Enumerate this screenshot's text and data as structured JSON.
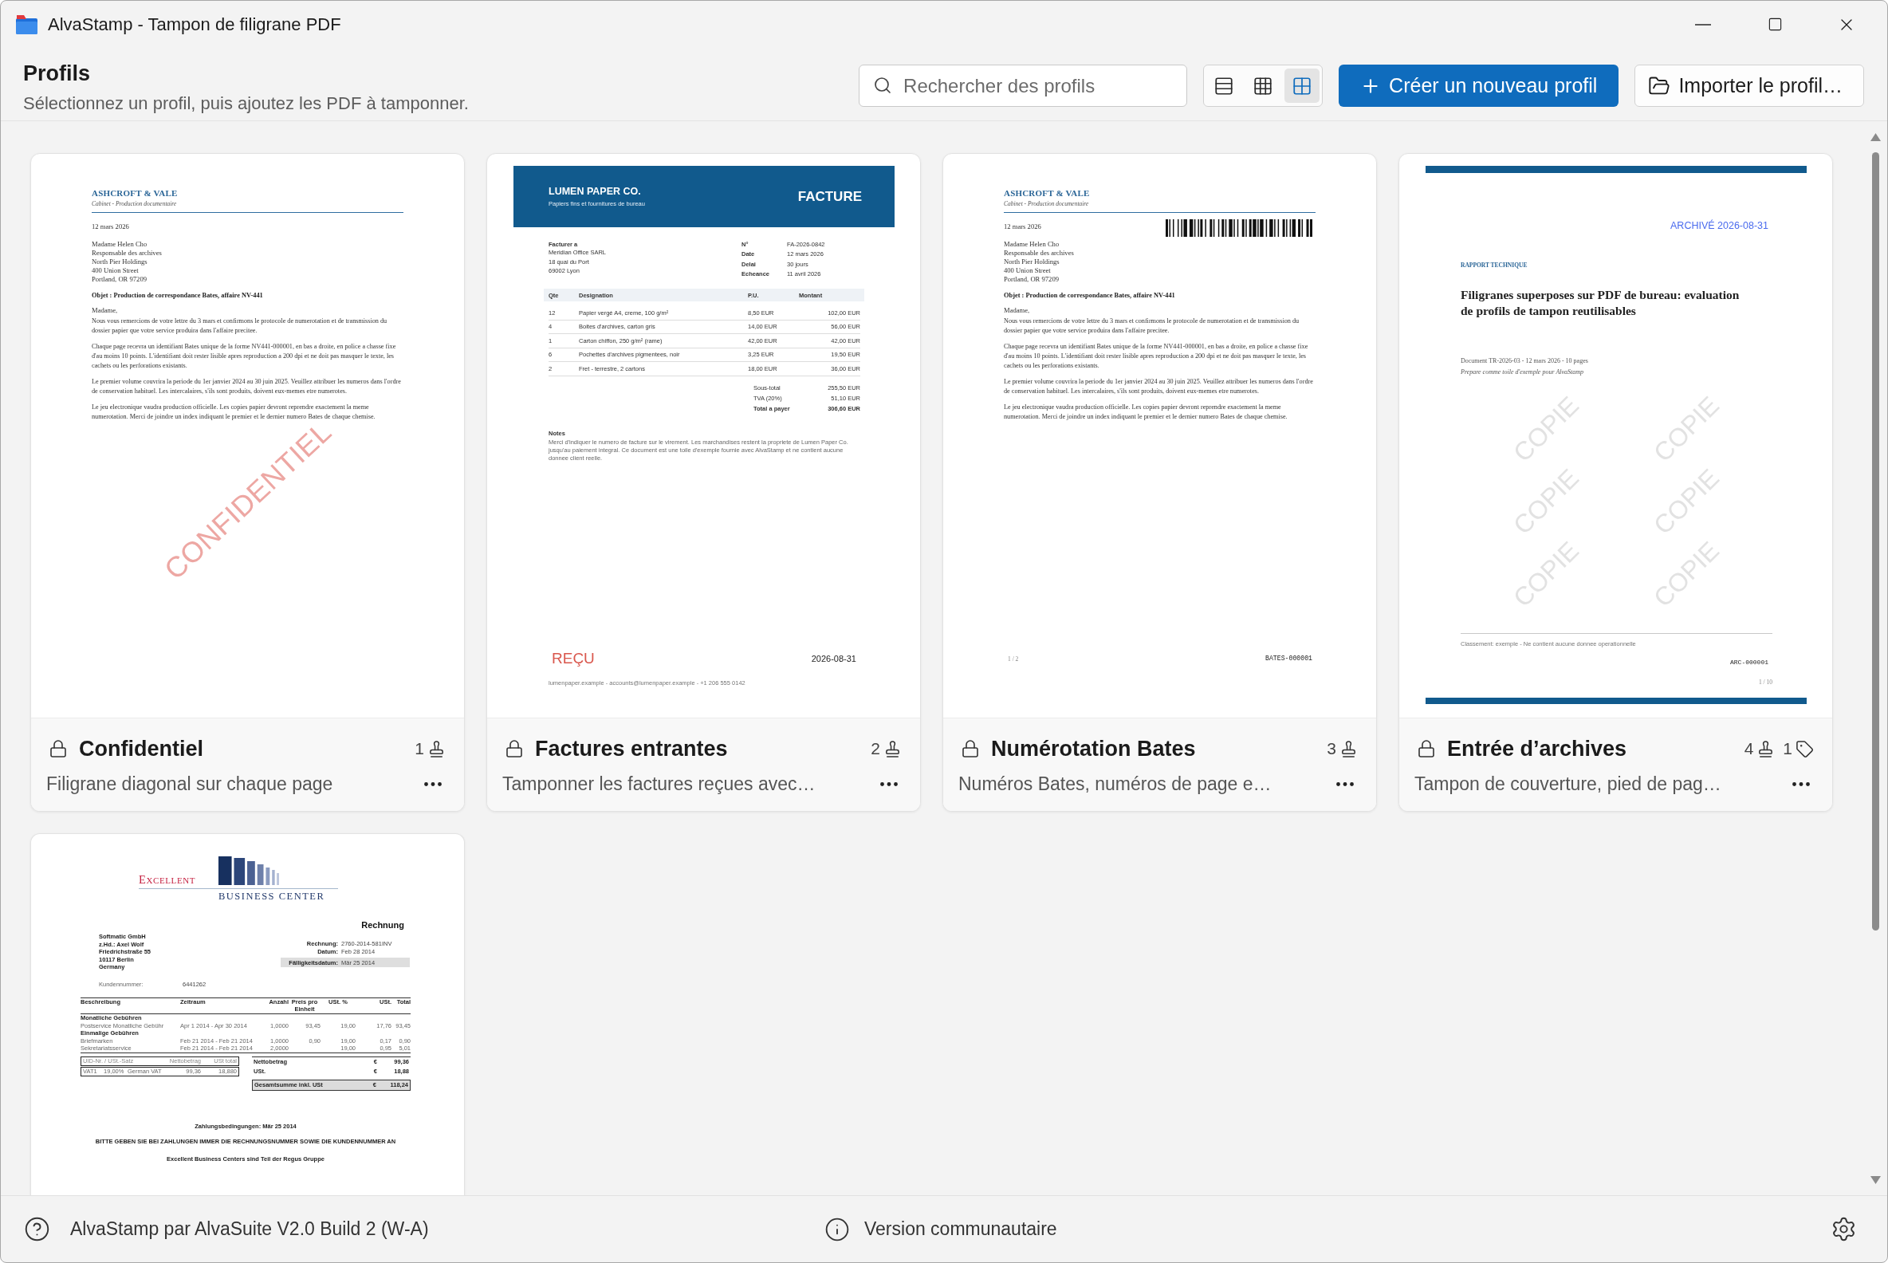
{
  "window": {
    "title": "AlvaStamp - Tampon de filigrane PDF"
  },
  "header": {
    "title": "Profils",
    "subtitle": "Sélectionnez un profil, puis ajoutez les PDF à tamponner.",
    "search": {
      "placeholder": "Rechercher des profils"
    },
    "view_modes": [
      {
        "kind": "list",
        "selected": false
      },
      {
        "kind": "grid",
        "selected": false
      },
      {
        "kind": "tiles",
        "selected": true
      }
    ],
    "create_button": "Créer un nouveau profil",
    "import_button": "Importer le profil…"
  },
  "profiles": [
    {
      "title": "Confidentiel",
      "description": "Filigrane diagonal sur chaque page",
      "locked": true,
      "stamp_count": "1",
      "preview": {
        "kind": "letter",
        "company": "ASHCROFT & VALE",
        "tagline": "Cabinet - Production documentaire",
        "date": "12 mars 2026",
        "address": [
          "Madame Helen Cho",
          "Responsable des archives",
          "North Pier Holdings",
          "400 Union Street",
          "Portland, OR 97209"
        ],
        "subject": "Objet : Production de correspondance Bates, affaire NV-441",
        "salutation": "Madame,",
        "paragraphs": [
          "Nous vous remercions de votre lettre du 3 mars et confirmons le protocole de numerotation et de transmission du dossier papier que votre service produira dans l'affaire precitee.",
          "Chaque page recevra un identifiant Bates unique de la forme NV441-000001, en bas a droite, en police a chasse fixe d'au moins 10 points. L'identifiant doit rester lisible apres reproduction a 200 dpi et ne doit pas masquer le texte, les cachets ou les perforations existants.",
          "Le premier volume couvrira la periode du 1er janvier 2024 au 30 juin 2025. Veuillez attribuer les numeros dans l'ordre de conservation habituel. Les intercalaires, s'ils sont produits, doivent eux-memes etre numerotes.",
          "Le jeu electronique vaudra production officielle. Les copies papier devront reprendre exactement la meme numerotation. Merci de joindre un index indiquant le premier et le dernier numero Bates de chaque chemise."
        ],
        "stamps": [
          {
            "kind": "diagonal",
            "text": "CONFIDENTIEL"
          }
        ]
      }
    },
    {
      "title": "Factures entrantes",
      "description": "Tamponner les factures reçues avec…",
      "locked": true,
      "stamp_count": "2",
      "preview": {
        "kind": "invoice",
        "company": "LUMEN PAPER CO.",
        "tagline": "Papiers fins et fournitures de bureau",
        "doc_title": "FACTURE",
        "bill_to_label": "Facturer a",
        "bill_to": [
          "Meridian Office SARL",
          "18 quai du Port",
          "69002 Lyon"
        ],
        "meta": [
          {
            "label": "N°",
            "value": "FA-2026-0842"
          },
          {
            "label": "Date",
            "value": "12 mars 2026"
          },
          {
            "label": "Delai",
            "value": "30 jours"
          },
          {
            "label": "Echeance",
            "value": "11 avril 2026"
          }
        ],
        "columns": [
          "Qte",
          "Designation",
          "P.U.",
          "Montant"
        ],
        "rows": [
          [
            "12",
            "Papier vergé A4, creme, 100 g/m²",
            "8,50 EUR",
            "102,00 EUR"
          ],
          [
            "4",
            "Boites d'archives, carton gris",
            "14,00 EUR",
            "56,00 EUR"
          ],
          [
            "1",
            "Carton chiffon, 250 g/m² (rame)",
            "42,00 EUR",
            "42,00 EUR"
          ],
          [
            "6",
            "Pochettes d'archives pigmentees, noir",
            "3,25 EUR",
            "19,50 EUR"
          ],
          [
            "2",
            "Fret - terrestre, 2 cartons",
            "18,00 EUR",
            "36,00 EUR"
          ]
        ],
        "totals": [
          {
            "label": "Sous-total",
            "value": "255,50 EUR",
            "grand": false
          },
          {
            "label": "TVA (20%)",
            "value": "51,10 EUR",
            "grand": false
          },
          {
            "label": "Total a payer",
            "value": "306,60 EUR",
            "grand": true
          }
        ],
        "notes_label": "Notes",
        "notes": "Merci d'indiquer le numero de facture sur le virement. Les marchandises restent la propriete de Lumen Paper Co. jusqu'au paiement integral. Ce document est une toile d'exemple fournie avec AlvaStamp et ne contient aucune donnee client reelle.",
        "footer": "lumenpaper.example - accounts@lumenpaper.example - +1 206 555 0142",
        "stamps": [
          {
            "kind": "received",
            "text": "REÇU"
          },
          {
            "kind": "date",
            "text": "2026-08-31"
          }
        ]
      }
    },
    {
      "title": "Numérotation Bates",
      "description": "Numéros Bates, numéros de page e…",
      "locked": true,
      "stamp_count": "3",
      "preview": {
        "kind": "letter",
        "company": "ASHCROFT & VALE",
        "tagline": "Cabinet - Production documentaire",
        "date": "12 mars 2026",
        "address": [
          "Madame Helen Cho",
          "Responsable des archives",
          "North Pier Holdings",
          "400 Union Street",
          "Portland, OR 97209"
        ],
        "subject": "Objet : Production de correspondance Bates, affaire NV-441",
        "salutation": "Madame,",
        "paragraphs": [
          "Nous vous remercions de votre lettre du 3 mars et confirmons le protocole de numerotation et de transmission du dossier papier que votre service produira dans l'affaire precitee.",
          "Chaque page recevra un identifiant Bates unique de la forme NV441-000001, en bas a droite, en police a chasse fixe d'au moins 10 points. L'identifiant doit rester lisible apres reproduction a 200 dpi et ne doit pas masquer le texte, les cachets ou les perforations existants.",
          "Le premier volume couvrira la periode du 1er janvier 2024 au 30 juin 2025. Veuillez attribuer les numeros dans l'ordre de conservation habituel. Les intercalaires, s'ils sont produits, doivent eux-memes etre numerotes.",
          "Le jeu electronique vaudra production officielle. Les copies papier devront reprendre exactement la meme numerotation. Merci de joindre un index indiquant le premier et le dernier numero Bates de chaque chemise."
        ],
        "stamps": [
          {
            "kind": "barcode"
          },
          {
            "kind": "page_number",
            "text": "1 / 2"
          },
          {
            "kind": "bates",
            "text": "BATES-000001"
          }
        ]
      }
    },
    {
      "title": "Entrée d’archives",
      "description": "Tampon de couverture, pied de pag…",
      "locked": true,
      "stamp_count": "4",
      "tag_count": "1",
      "preview": {
        "kind": "report",
        "eyebrow": "RAPPORT TECHNIQUE",
        "title": "Filigranes superposes sur PDF de bureau: evaluation de profils de tampon reutilisables",
        "meta": "Document TR-2026-03 - 12 mars 2026 - 10 pages",
        "note": "Prepare comme toile d'exemple pour AlvaStamp",
        "footer": "Classement: exemple - Ne contient aucune donnee operationnelle",
        "stamps": [
          {
            "kind": "tiled",
            "text": "COPIE"
          },
          {
            "kind": "tiled",
            "text": "COPIE"
          },
          {
            "kind": "tiled",
            "text": "COPIE"
          },
          {
            "kind": "tiled",
            "text": "COPIE"
          },
          {
            "kind": "tiled",
            "text": "COPIE"
          },
          {
            "kind": "tiled",
            "text": "COPIE"
          },
          {
            "kind": "archived",
            "text": "ARCHIVÉ 2026-08-31"
          },
          {
            "kind": "bates",
            "text": "ARC-000001"
          },
          {
            "kind": "page_number",
            "text": "1 / 10"
          }
        ]
      }
    },
    {
      "preview": {
        "kind": "rechnung",
        "logo_top": "EXCELLENT",
        "logo_bottom": "BUSINESS CENTER",
        "doc_title": "Rechnung",
        "recipient": [
          "Softmatic GmbH",
          "z.Hd.: Axel Wolf",
          "Friedrichstraße 55",
          "10117 Berlin",
          "Germany"
        ],
        "meta": [
          {
            "label": "Rechnung:",
            "value": "2760-2014-581INV",
            "highlight": false
          },
          {
            "label": "Datum:",
            "value": "Feb 28 2014",
            "highlight": false
          },
          {
            "label": "Fälligkeitsdatum:",
            "value": "Mär 25 2014",
            "highlight": true
          }
        ],
        "customer": {
          "label": "Kundennummer:",
          "value": "6441262"
        },
        "columns": [
          "Beschreibung",
          "Zeitraum",
          "Anzahl",
          "Preis pro Einheit",
          "USt. %",
          "USt.",
          "Total"
        ],
        "groups": [
          {
            "title": "Monatliche Gebühren",
            "rows": [
              [
                "Postservice Monatliche Gebühr",
                "Apr 1 2014 - Apr 30 2014",
                "1,0000",
                "93,45",
                "19,00",
                "17,76",
                "93,45"
              ]
            ]
          },
          {
            "title": "Einmalige Gebühren",
            "rows": [
              [
                "Briefmarken",
                "Feb 21 2014 - Feb 21 2014",
                "1,0000",
                "0,90",
                "19,00",
                "0,17",
                "0,90"
              ],
              [
                "Sekretariatsservice",
                "Feb 21 2014 - Feb 21 2014",
                "2,0000",
                null,
                "19,00",
                "0,95",
                "5,01"
              ]
            ]
          }
        ],
        "vat_summary": {
          "code_label": "UID-Nr. / USt.-Satz",
          "net_label": "Nettobetrag",
          "tax_label": "USt total",
          "entries": [
            {
              "code": "VAT1",
              "rate": "19,00%",
              "name": "German VAT",
              "net": "99,36",
              "tax": "18,880"
            }
          ]
        },
        "totals": [
          {
            "label": "Nettobetrag",
            "currency": "€",
            "value": "99,36",
            "grand": false
          },
          {
            "label": "USt.",
            "currency": "€",
            "value": "18,88",
            "grand": false
          },
          {
            "label": "Gesamtsumme inkl. USt",
            "currency": "€",
            "value": "118,24",
            "grand": true
          }
        ],
        "terms": "Zahlungsbedingungen: Mär 25 2014",
        "notice": "BITTE GEBEN SIE BEI ZAHLUNGEN IMMER DIE RECHNUNGSNUMMER SOWIE DIE KUNDENNUMMER AN",
        "footer": "Excellent Business Centers sind Teil der Regus Gruppe"
      }
    }
  ],
  "status_bar": {
    "product": "AlvaStamp par AlvaSuite V2.0 Build 2 (W-A)",
    "edition": "Version communautaire"
  }
}
